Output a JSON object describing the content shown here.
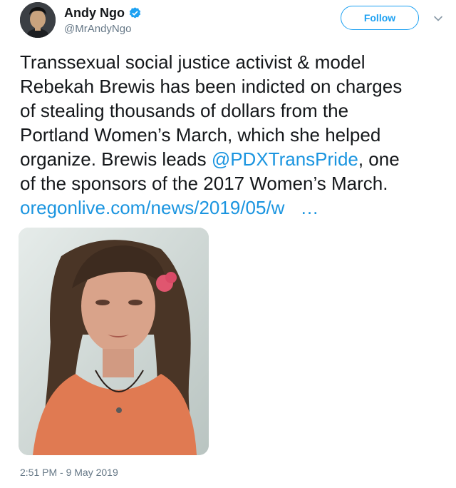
{
  "author": {
    "display_name": "Andy Ngo",
    "handle": "@MrAndyNgo",
    "verified": true
  },
  "actions": {
    "follow_label": "Follow"
  },
  "tweet": {
    "lines": [
      "Transsexual social justice activist & model",
      "Rebekah Brewis has been indicted on charges",
      "of stealing thousands of dollars from the",
      "Portland Women’s March, which she helped",
      "organize. Brewis leads"
    ],
    "mention": "@PDXTransPride",
    "after_mention": ", one",
    "line_last": "of the sponsors of the 2017 Women’s March.",
    "link_text": "oregonlive.com/news/2019/05/w",
    "link_ellipsis": "…"
  },
  "timestamp": "2:51 PM - 9 May 2019",
  "colors": {
    "accent": "#1da1f2",
    "link": "#1b95e0",
    "muted": "#657786"
  },
  "icons": [
    "verified-badge-icon",
    "chevron-down-icon"
  ]
}
